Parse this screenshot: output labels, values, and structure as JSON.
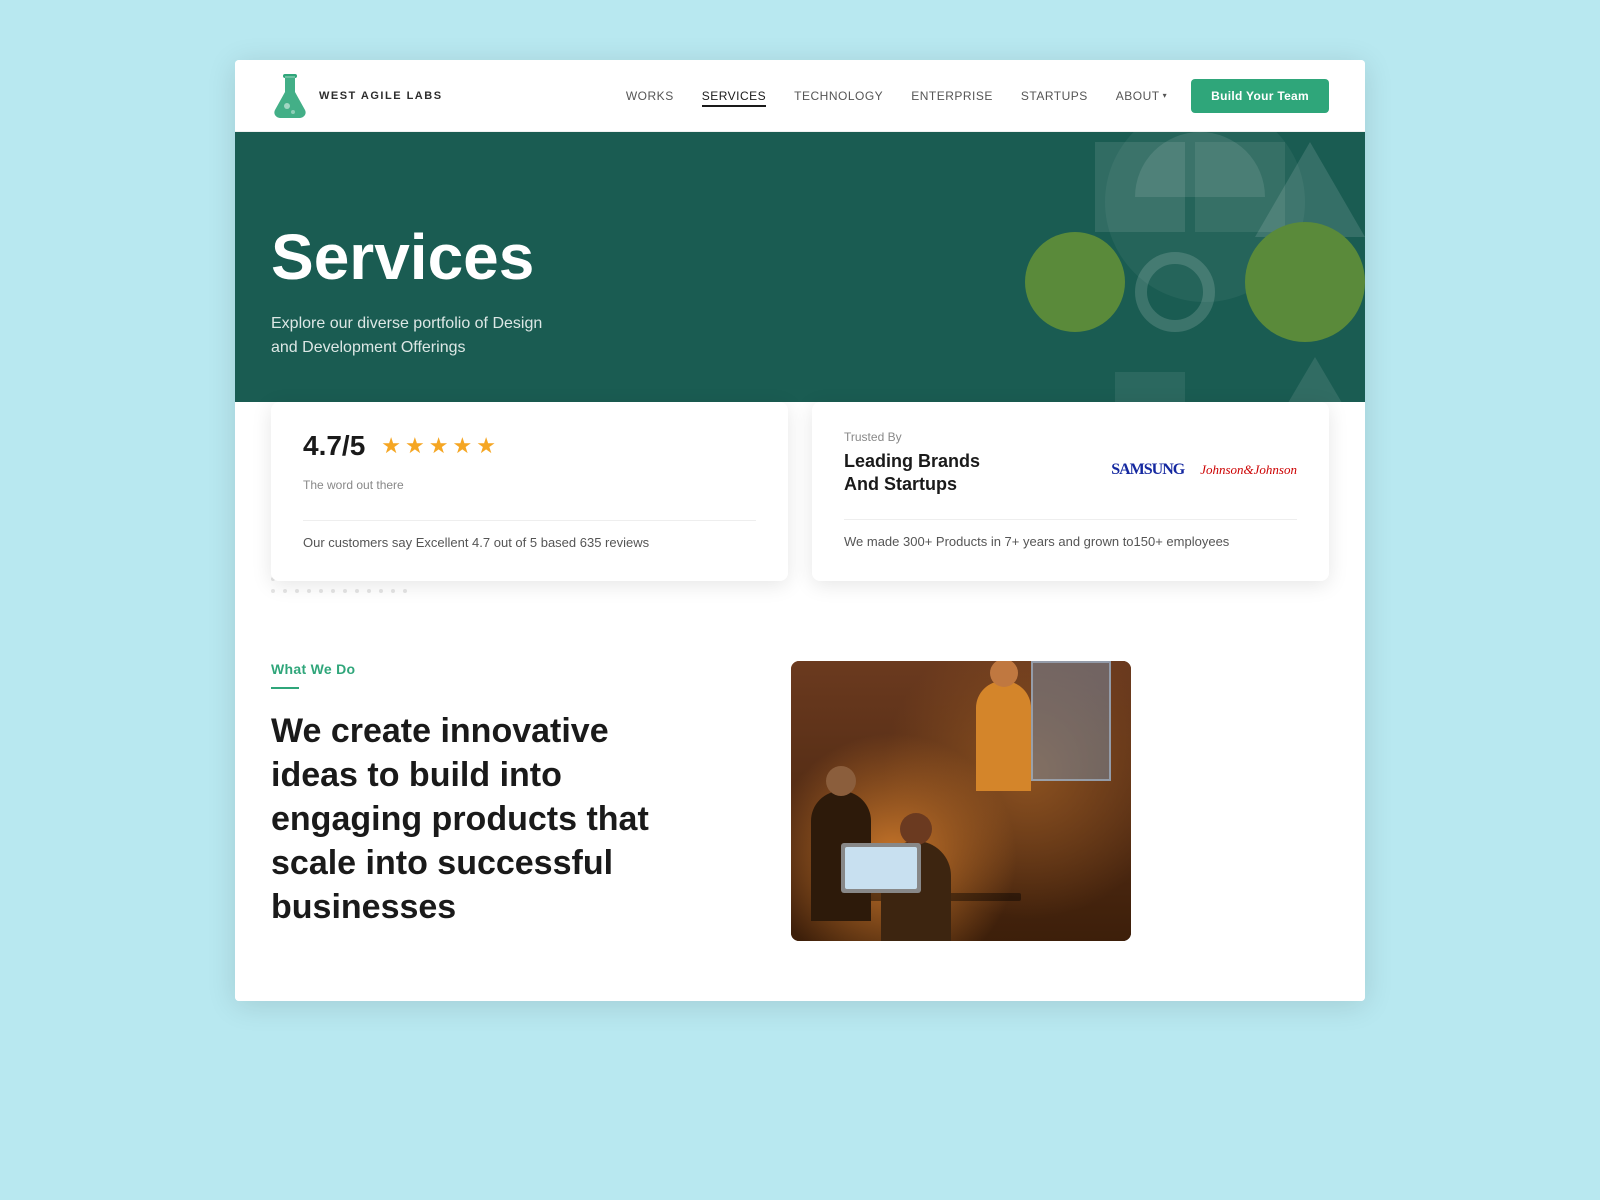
{
  "meta": {
    "title": "West Agile Labs - Services"
  },
  "navbar": {
    "logo_text": "WEST AGILE LABS",
    "nav_items": [
      {
        "id": "works",
        "label": "WORKS",
        "active": false
      },
      {
        "id": "services",
        "label": "SERVICES",
        "active": true
      },
      {
        "id": "technology",
        "label": "TECHNOLOGY",
        "active": false
      },
      {
        "id": "enterprise",
        "label": "ENTERPRISE",
        "active": false
      },
      {
        "id": "startups",
        "label": "STARTUPS",
        "active": false
      },
      {
        "id": "about",
        "label": "ABOUT",
        "active": false
      }
    ],
    "cta_label": "Build Your Team"
  },
  "hero": {
    "title": "Services",
    "subtitle_line1": "Explore our diverse portfolio of Design",
    "subtitle_line2": "and Development Offerings"
  },
  "stats": {
    "card1": {
      "rating": "4.7/5",
      "rating_label": "The word out there",
      "description": "Our customers say Excellent 4.7 out of 5 based 635 reviews"
    },
    "card2": {
      "trusted_by_label": "Trusted By",
      "title_line1": "Leading Brands",
      "title_line2": "And Startups",
      "logo1": "SAMSUNG",
      "logo2": "Johnson&Johnson",
      "description": "We made 300+ Products in 7+ years and grown to150+ employees"
    }
  },
  "what_we_do": {
    "label": "What We Do",
    "heading_line1": "We create innovative",
    "heading_line2": "ideas to build into",
    "heading_line3": "engaging products that",
    "heading_line4": "scale into successful",
    "heading_line5": "businesses"
  }
}
